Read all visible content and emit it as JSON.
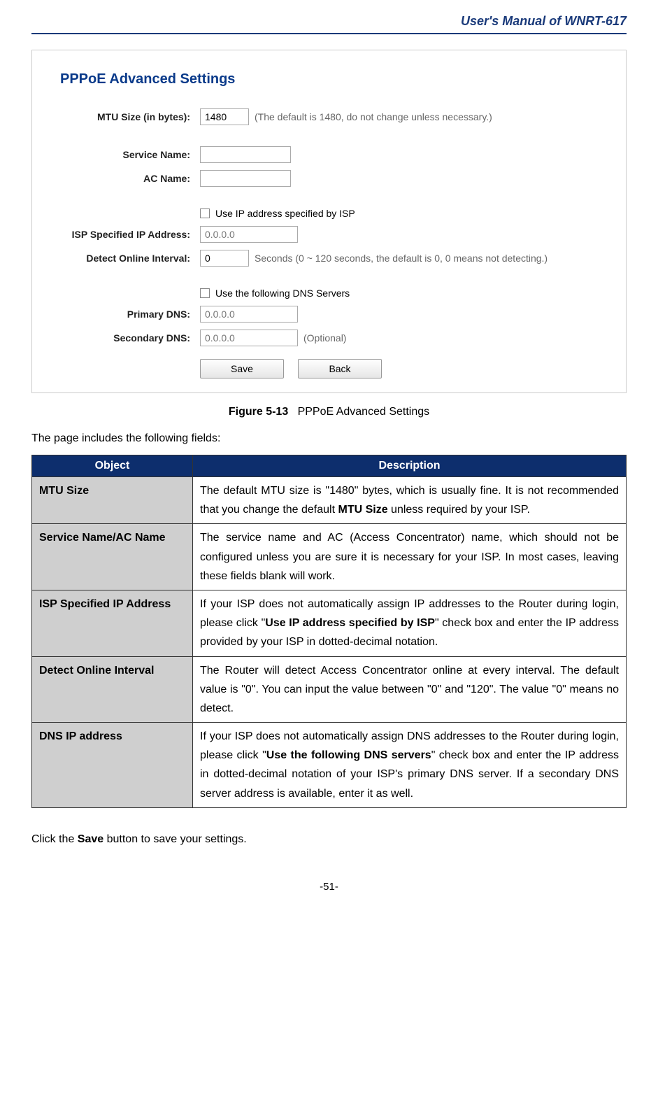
{
  "header": {
    "manual_title": "User's Manual of WNRT-617"
  },
  "screenshot": {
    "panel_title": "PPPoE Advanced Settings",
    "mtu": {
      "label": "MTU Size (in bytes):",
      "value": "1480",
      "note": "(The default is 1480, do not change unless necessary.)"
    },
    "service_name": {
      "label": "Service Name:",
      "value": ""
    },
    "ac_name": {
      "label": "AC Name:",
      "value": ""
    },
    "isp_checkbox": "Use IP address specified by ISP",
    "isp_ip": {
      "label": "ISP Specified IP Address:",
      "placeholder": "0.0.0.0"
    },
    "detect": {
      "label": "Detect Online Interval:",
      "value": "0",
      "note": "Seconds (0 ~ 120 seconds, the default is 0, 0 means not detecting.)"
    },
    "dns_checkbox": "Use the following DNS Servers",
    "primary_dns": {
      "label": "Primary DNS:",
      "placeholder": "0.0.0.0"
    },
    "secondary_dns": {
      "label": "Secondary DNS:",
      "placeholder": "0.0.0.0",
      "note": "(Optional)"
    },
    "buttons": {
      "save": "Save",
      "back": "Back"
    }
  },
  "figure": {
    "num": "Figure 5-13",
    "title": "PPPoE Advanced Settings"
  },
  "intro": "The page includes the following fields:",
  "table": {
    "head": {
      "object": "Object",
      "description": "Description"
    },
    "rows": [
      {
        "object": "MTU Size",
        "desc_pre": "The default MTU size is \"1480\" bytes, which is usually fine. It is not recommended that you change the default ",
        "bold1": "MTU Size",
        "desc_post": " unless required by your ISP."
      },
      {
        "object": "Service Name/AC Name",
        "desc": "The service name and AC (Access Concentrator) name, which should not be configured unless you are sure it is necessary for your ISP. In most cases, leaving these fields blank will work."
      },
      {
        "object": "ISP Specified IP Address",
        "desc_pre": "If your ISP does not automatically assign IP addresses to the Router during login, please click \"",
        "bold1": "Use IP address specified by ISP",
        "desc_post": "\" check box and enter the IP address provided by your ISP in dotted-decimal notation."
      },
      {
        "object": "Detect Online Interval",
        "desc": "The Router will detect Access Concentrator online at every interval. The default value is \"0\". You can input the value between \"0\" and \"120\". The value \"0\" means no detect."
      },
      {
        "object": "DNS IP address",
        "desc_pre": "If your ISP does not automatically assign DNS addresses to the Router during login, please click \"",
        "bold1": "Use the following DNS servers",
        "desc_post": "\" check box and enter the IP address in dotted-decimal notation of your ISP's primary DNS server. If a secondary DNS server address is available, enter it as well."
      }
    ]
  },
  "closing": {
    "pre": "Click the ",
    "bold": "Save",
    "post": " button to save your settings."
  },
  "page_num": "-51-"
}
